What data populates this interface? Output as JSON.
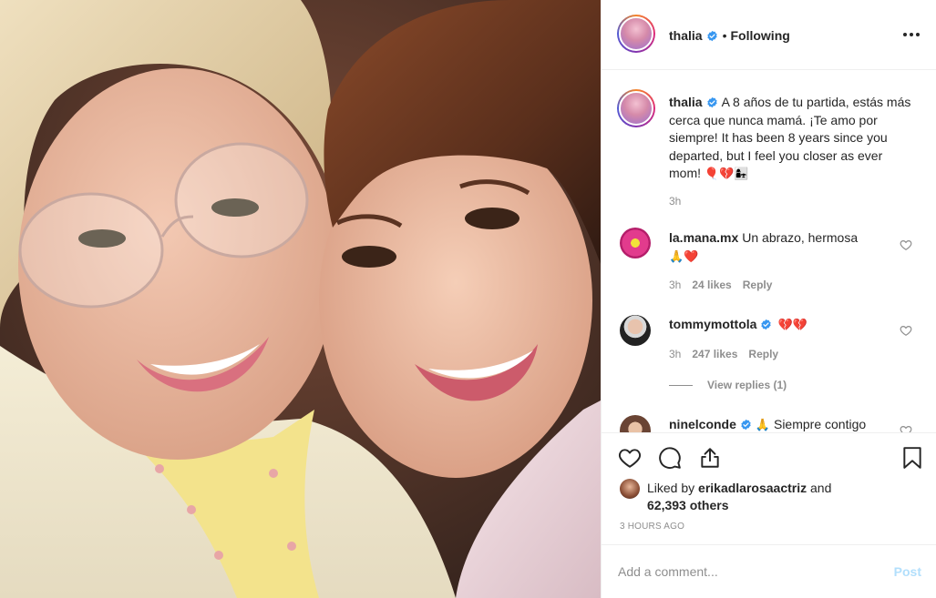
{
  "post": {
    "photo_alt": "Photo of two smiling women cheek to cheek",
    "author": {
      "username": "thalia",
      "verified": true,
      "follow_status": "Following",
      "separator": "•"
    },
    "caption": {
      "username": "thalia",
      "text": "A 8 años de tu partida, estás más cerca que nunca mamá. ¡Te amo por siempre! It has been 8 years since you departed, but I feel you closer as ever mom!",
      "emojis": "🎈💔👩‍👧",
      "time": "3h"
    },
    "comments": [
      {
        "username": "la.mana.mx",
        "verified": false,
        "text": "Un abrazo, hermosa",
        "emojis": "🙏❤️",
        "time": "3h",
        "likes": "24 likes",
        "reply": "Reply"
      },
      {
        "username": "tommymottola",
        "verified": true,
        "text": "",
        "emojis": "💔💔",
        "time": "3h",
        "likes": "247 likes",
        "reply": "Reply",
        "view_replies": "View replies (1)"
      },
      {
        "username": "ninelconde",
        "verified": true,
        "text": "Siempre contigo",
        "emojis": "🙏"
      }
    ],
    "likes": {
      "prefix": "Liked by",
      "user": "erikadlarosaactriz",
      "joiner": "and",
      "others": "62,393 others"
    },
    "timestamp": "3 hours ago",
    "add_comment": {
      "placeholder": "Add a comment...",
      "post_label": "Post"
    },
    "icons": {
      "more": "more-options-icon",
      "like": "heart-icon",
      "comment": "comment-icon",
      "share": "share-icon",
      "save": "bookmark-icon",
      "verified": "verified-badge-icon"
    },
    "colors": {
      "verified": "#3897f0",
      "muted": "#8e8e8e",
      "post_disabled": "#b2dffc",
      "heart_red": "#e0245e"
    }
  }
}
